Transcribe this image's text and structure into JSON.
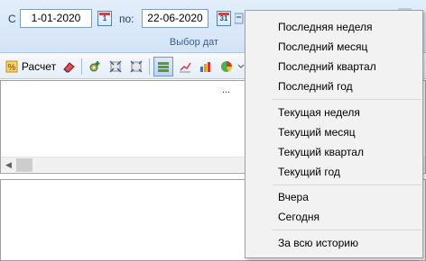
{
  "date_panel": {
    "from_label": "С",
    "from_value": "1-01-2020",
    "from_calendar_day": "1",
    "to_label": "по:",
    "to_value": "22-06-2020",
    "to_calendar_day": "31",
    "group_label": "Выбор дат"
  },
  "toolbar": {
    "calculate_label": "Расчет"
  },
  "top_panel": {
    "ellipsis": "..."
  },
  "menu": {
    "items": [
      "Последняя неделя",
      "Последний месяц",
      "Последний квартал",
      "Последний год",
      "Текущая неделя",
      "Текущий месяц",
      "Текущий квартал",
      "Текущий год",
      "Вчера",
      "Сегодня",
      "За всю историю"
    ]
  }
}
